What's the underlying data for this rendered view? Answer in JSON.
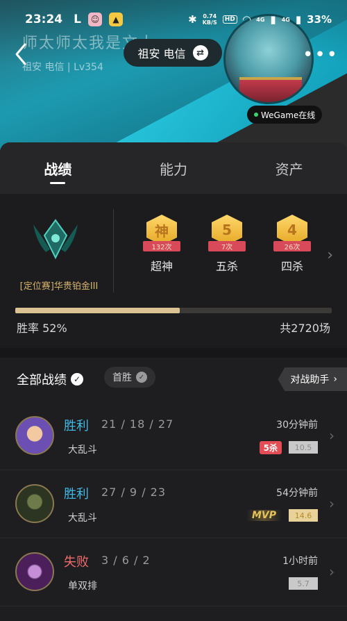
{
  "status_bar": {
    "time": "23:24",
    "l": "L",
    "net_speed_value": "0.74",
    "net_speed_unit": "KB/S",
    "hd": "HD",
    "signal1": "4G",
    "signal2": "4G",
    "battery": "33%"
  },
  "profile": {
    "name": "师太师太我是文大",
    "sub": "祖安 电信 | Lv354",
    "server_pill": "祖安 电信",
    "wegame_status": "WeGame在线"
  },
  "tabs": [
    {
      "label": "战绩"
    },
    {
      "label": "能力"
    },
    {
      "label": "资产"
    }
  ],
  "rank": {
    "label": "[定位赛]华贵铂金III"
  },
  "medals": [
    {
      "glyph": "神",
      "count": "132次",
      "label": "超神"
    },
    {
      "glyph": "5",
      "count": "7次",
      "label": "五杀"
    },
    {
      "glyph": "4",
      "count": "26次",
      "label": "四杀"
    }
  ],
  "stats": {
    "win_rate_text": "胜率  52%",
    "win_rate_fraction": 0.52,
    "total_text": "共2720场"
  },
  "records": {
    "title": "全部战绩",
    "first_win": "首胜",
    "assist_button": "对战助手"
  },
  "matches": [
    {
      "result": "胜利",
      "kda": "21 / 18 / 27",
      "mode": "大乱斗",
      "when": "30分钟前",
      "score": "10.5",
      "badge": "5杀",
      "avatar_color": "#6b4fb3"
    },
    {
      "result": "胜利",
      "kda": "27 / 9 / 23",
      "mode": "大乱斗",
      "when": "54分钟前",
      "score": "14.6",
      "badge": "MVP",
      "avatar_color": "#3a4a2e"
    },
    {
      "result": "失败",
      "kda": "3 / 6 / 2",
      "mode": "单双排",
      "when": "1小时前",
      "score": "5.7",
      "badge": "",
      "avatar_color": "#5b2a6a"
    }
  ],
  "colors": {
    "win": "#3fb9e8",
    "lose": "#f06c6c",
    "accent_gold": "#dcc394"
  }
}
